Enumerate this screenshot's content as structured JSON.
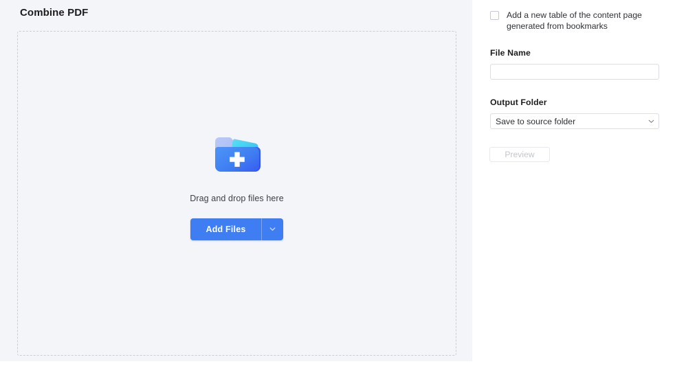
{
  "page": {
    "title": "Combine PDF"
  },
  "colors": {
    "accent": "#3f7ef2",
    "panel_bg": "#f4f5f9",
    "dropzone_border": "#c9cdd8",
    "text_primary": "#1c1c1e",
    "disabled_text": "#c2c5cc"
  },
  "dropzone": {
    "icon_name": "add-folder-icon",
    "hint_text": "Drag and drop files here",
    "add_files_label": "Add Files",
    "add_files_caret_icon": "chevron-down-icon"
  },
  "options": {
    "toc_checkbox": {
      "label": "Add a new table of the content page generated from bookmarks",
      "checked": false
    },
    "file_name": {
      "label": "File Name",
      "value": "",
      "placeholder": ""
    },
    "output_folder": {
      "label": "Output Folder",
      "selected": "Save to source folder",
      "caret_icon": "chevron-down-icon",
      "options": [
        "Save to source folder"
      ]
    },
    "preview_button": {
      "label": "Preview",
      "disabled": true
    }
  }
}
